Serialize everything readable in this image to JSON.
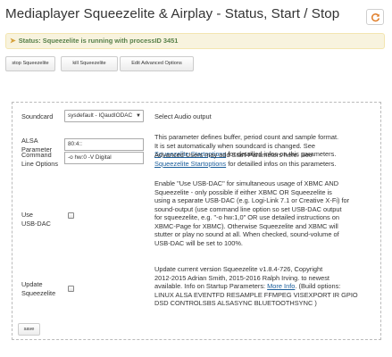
{
  "page": {
    "title": "Mediaplayer Squeezelite & Airplay - Status, Start / Stop"
  },
  "status": {
    "text": "Status: Squeezelite is running with processID 3451",
    "icon": "warning-icon"
  },
  "toolbar": {
    "stop_label": "stop Squeezelite",
    "kill_label": "kill Squeezelite",
    "edit_label": "Edit Advanced Options"
  },
  "form": {
    "soundcard": {
      "label": "Soundcard",
      "selected": "sysdefault - IQaudIODAC",
      "desc": "Select Audio output"
    },
    "alsa": {
      "label": [
        "ALSA",
        "Parameter"
      ],
      "value": "80:4::",
      "desc": [
        "This parameter defines buffer, period count and sample format.",
        "It is set automatically when soundcard is changed. See",
        "for detailled infos on this parameters."
      ],
      "link": "Squeezelite Startoptions"
    },
    "cmdline": {
      "label": [
        "Command",
        "Line Options"
      ],
      "value": "-o hw:0 -V Digital",
      "desc": [
        "Advanced Users may add Start-Parameters here. See",
        "for detailled infos on this parameters."
      ],
      "link": "Squeezelite Startoptions"
    },
    "usbdac": {
      "label": [
        "Use",
        "USB-DAC"
      ],
      "checked": false,
      "desc": [
        "Enable \"Use USB-DAC\" for simultaneous usage of XBMC AND",
        "Squeezelite - only possible if either XBMC OR Squeezelite is",
        "using a separate USB-DAC (e.g. Logi-Link 7.1 or Creative X-Fi) for",
        "sound-output (use command line option so set USB-DAC output",
        "for squeezelite, e.g. \"-o hw:1,0\" OR use detailed instructions on",
        "XBMC-Page for XBMC). Otherwise Squeezelite and XBMC will",
        "stutter or play no sound at all. When checked, sound-volume of",
        "USB-DAC will be set to 100%."
      ]
    },
    "update": {
      "label": [
        "Update",
        "Squeezelite"
      ],
      "checked": false,
      "desc": [
        "Update current version Squeezelite v1.8.4-726, Copyright",
        "2012-2015 Adrian Smith, 2015-2016 Ralph Irving. to newest",
        "available. Info on Startup Parameters:",
        ". (Build options:",
        "LINUX ALSA EVENTFD RESAMPLE FFMPEG VISEXPORT IR GPIO",
        "DSD CONTROLSBS ALSASYNC BLUETOOTHSYNC )"
      ],
      "link": "More Info"
    },
    "save_label": "save"
  }
}
